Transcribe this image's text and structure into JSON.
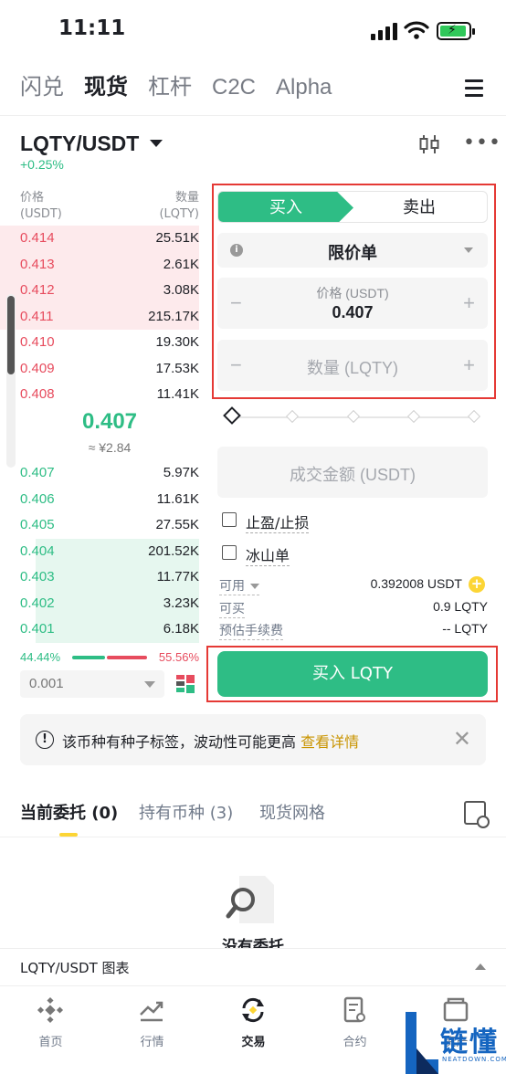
{
  "status": {
    "time": "11:11"
  },
  "top_tabs": [
    "闪兑",
    "现货",
    "杠杆",
    "C2C",
    "Alpha"
  ],
  "pair": {
    "name": "LQTY/USDT",
    "change": "+0.25%"
  },
  "orderbook": {
    "price_header": "价格",
    "price_unit": "(USDT)",
    "qty_header": "数量",
    "qty_unit": "(LQTY)",
    "asks": [
      {
        "price": "0.414",
        "qty": "25.51K",
        "depth": 1.0
      },
      {
        "price": "0.413",
        "qty": "2.61K",
        "depth": 1.0
      },
      {
        "price": "0.412",
        "qty": "3.08K",
        "depth": 1.0
      },
      {
        "price": "0.411",
        "qty": "215.17K",
        "depth": 1.0
      },
      {
        "price": "0.410",
        "qty": "19.30K",
        "depth": 0
      },
      {
        "price": "0.409",
        "qty": "17.53K",
        "depth": 0
      },
      {
        "price": "0.408",
        "qty": "11.41K",
        "depth": 0
      }
    ],
    "mid_price": "0.407",
    "mid_cny": "≈ ¥2.84",
    "bids": [
      {
        "price": "0.407",
        "qty": "5.97K",
        "depth": 0
      },
      {
        "price": "0.406",
        "qty": "11.61K",
        "depth": 0
      },
      {
        "price": "0.405",
        "qty": "27.55K",
        "depth": 0
      },
      {
        "price": "0.404",
        "qty": "201.52K",
        "depth": 0.82
      },
      {
        "price": "0.403",
        "qty": "11.77K",
        "depth": 0.82
      },
      {
        "price": "0.402",
        "qty": "3.23K",
        "depth": 0.82
      },
      {
        "price": "0.401",
        "qty": "6.18K",
        "depth": 0.82
      }
    ],
    "buy_ratio": "44.44%",
    "sell_ratio": "55.56%",
    "precision": "0.001"
  },
  "form": {
    "buy_tab": "买入",
    "sell_tab": "卖出",
    "order_type": "限价单",
    "price_label": "价格 (USDT)",
    "price_value": "0.407",
    "qty_placeholder": "数量 (LQTY)",
    "amount_placeholder": "成交金额 (USDT)",
    "tp_sl": "止盈/止损",
    "iceberg": "冰山单",
    "available_label": "可用",
    "available_value": "0.392008 USDT",
    "can_buy_label": "可买",
    "can_buy_value": "0.9 LQTY",
    "fee_label": "预估手续费",
    "fee_value": "-- LQTY",
    "buy_button": "买入 LQTY"
  },
  "notice": {
    "text": "该币种有种子标签，波动性可能更高",
    "link": "查看详情"
  },
  "sub_tabs": {
    "open_orders": "当前委托 (0)",
    "holdings": "持有币种 (3)",
    "grid": "现货网格"
  },
  "empty_text": "没有委托",
  "chart_bar": "LQTY/USDT 图表",
  "bottom_nav": [
    "首页",
    "行情",
    "交易",
    "合约",
    "资产"
  ],
  "watermark": {
    "big": "链懂",
    "small": "NEATDOWN.COM"
  },
  "colors": {
    "buy": "#2ebd85",
    "sell": "#e74c5e",
    "accent": "#fcd535",
    "highlight_box": "#e53935"
  }
}
